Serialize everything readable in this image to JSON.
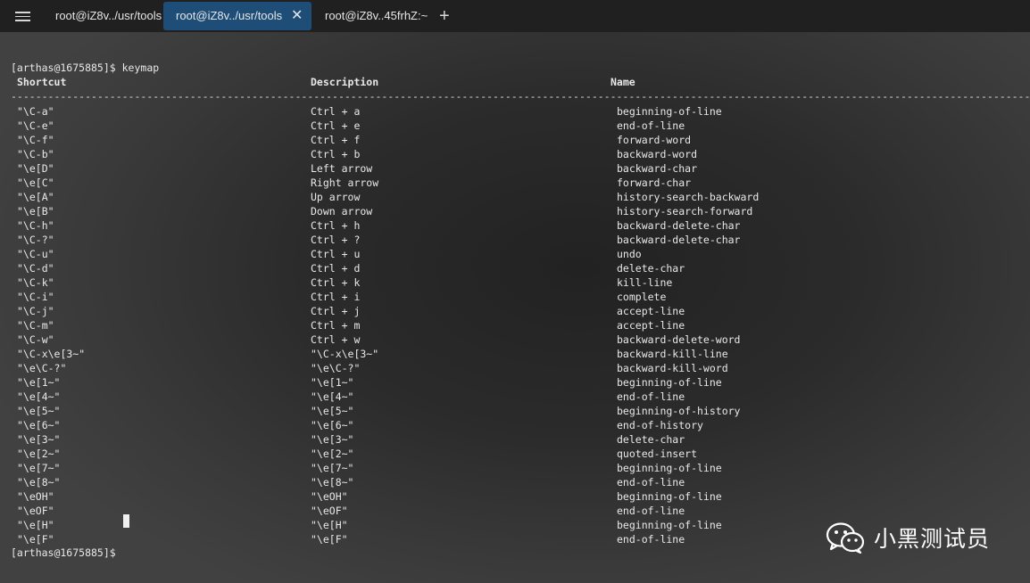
{
  "tabs": {
    "menu_icon": "hamburger-icon",
    "items": [
      {
        "label": "root@iZ8v../usr/tools",
        "active": false
      },
      {
        "label": "root@iZ8v../usr/tools",
        "active": true,
        "close_icon": "✕"
      },
      {
        "label": "root@iZ8v..45frhZ:~",
        "active": false
      }
    ],
    "new_tab_icon": "+",
    "active_color": "#1e4e78"
  },
  "terminal": {
    "command_line": "[arthas@1675885]$ keymap",
    "headers": [
      "Shortcut",
      "Description",
      "Name"
    ],
    "separator": "---------------------------------------------------------------------------------------------------------------------------------------------------------------------------------------------",
    "rows": [
      {
        "shortcut": "\"\\C-a\"",
        "description": "Ctrl + a",
        "name": "beginning-of-line"
      },
      {
        "shortcut": "\"\\C-e\"",
        "description": "Ctrl + e",
        "name": "end-of-line"
      },
      {
        "shortcut": "\"\\C-f\"",
        "description": "Ctrl + f",
        "name": "forward-word"
      },
      {
        "shortcut": "\"\\C-b\"",
        "description": "Ctrl + b",
        "name": "backward-word"
      },
      {
        "shortcut": "\"\\e[D\"",
        "description": "Left arrow",
        "name": "backward-char"
      },
      {
        "shortcut": "\"\\e[C\"",
        "description": "Right arrow",
        "name": "forward-char"
      },
      {
        "shortcut": "\"\\e[A\"",
        "description": "Up arrow",
        "name": "history-search-backward"
      },
      {
        "shortcut": "\"\\e[B\"",
        "description": "Down arrow",
        "name": "history-search-forward"
      },
      {
        "shortcut": "\"\\C-h\"",
        "description": "Ctrl + h",
        "name": "backward-delete-char"
      },
      {
        "shortcut": "\"\\C-?\"",
        "description": "Ctrl + ?",
        "name": "backward-delete-char"
      },
      {
        "shortcut": "\"\\C-u\"",
        "description": "Ctrl + u",
        "name": "undo"
      },
      {
        "shortcut": "\"\\C-d\"",
        "description": "Ctrl + d",
        "name": "delete-char"
      },
      {
        "shortcut": "\"\\C-k\"",
        "description": "Ctrl + k",
        "name": "kill-line"
      },
      {
        "shortcut": "\"\\C-i\"",
        "description": "Ctrl + i",
        "name": "complete"
      },
      {
        "shortcut": "\"\\C-j\"",
        "description": "Ctrl + j",
        "name": "accept-line"
      },
      {
        "shortcut": "\"\\C-m\"",
        "description": "Ctrl + m",
        "name": "accept-line"
      },
      {
        "shortcut": "\"\\C-w\"",
        "description": "Ctrl + w",
        "name": "backward-delete-word"
      },
      {
        "shortcut": "\"\\C-x\\e[3~\"",
        "description": "\"\\C-x\\e[3~\"",
        "name": "backward-kill-line"
      },
      {
        "shortcut": "\"\\e\\C-?\"",
        "description": "\"\\e\\C-?\"",
        "name": "backward-kill-word"
      },
      {
        "shortcut": "\"\\e[1~\"",
        "description": "\"\\e[1~\"",
        "name": "beginning-of-line"
      },
      {
        "shortcut": "\"\\e[4~\"",
        "description": "\"\\e[4~\"",
        "name": "end-of-line"
      },
      {
        "shortcut": "\"\\e[5~\"",
        "description": "\"\\e[5~\"",
        "name": "beginning-of-history"
      },
      {
        "shortcut": "\"\\e[6~\"",
        "description": "\"\\e[6~\"",
        "name": "end-of-history"
      },
      {
        "shortcut": "\"\\e[3~\"",
        "description": "\"\\e[3~\"",
        "name": "delete-char"
      },
      {
        "shortcut": "\"\\e[2~\"",
        "description": "\"\\e[2~\"",
        "name": "quoted-insert"
      },
      {
        "shortcut": "\"\\e[7~\"",
        "description": "\"\\e[7~\"",
        "name": "beginning-of-line"
      },
      {
        "shortcut": "\"\\e[8~\"",
        "description": "\"\\e[8~\"",
        "name": "end-of-line"
      },
      {
        "shortcut": "\"\\eOH\"",
        "description": "\"\\eOH\"",
        "name": "beginning-of-line"
      },
      {
        "shortcut": "\"\\eOF\"",
        "description": "\"\\eOF\"",
        "name": "end-of-line"
      },
      {
        "shortcut": "\"\\e[H\"",
        "description": "\"\\e[H\"",
        "name": "beginning-of-line"
      },
      {
        "shortcut": "\"\\e[F\"",
        "description": "\"\\e[F\"",
        "name": "end-of-line"
      }
    ],
    "prompt": "[arthas@1675885]$"
  },
  "watermark": {
    "icon": "wechat-icon",
    "text": "小黑测试员"
  }
}
